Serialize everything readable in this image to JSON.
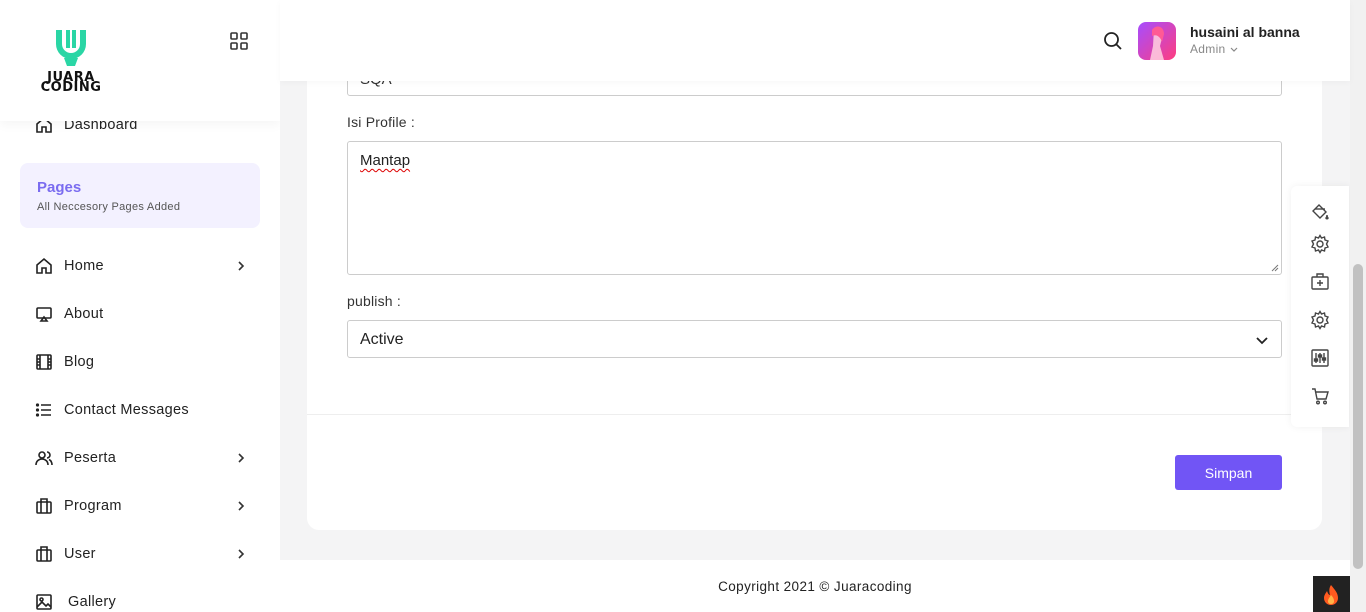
{
  "brand": {
    "logo_line1": "JUARA",
    "logo_line2": "CODING",
    "accent": "#2ad6a5"
  },
  "sidebar": {
    "dashboard_label": "Dashboard",
    "section": {
      "title": "Pages",
      "subtitle": "All Neccesory Pages Added"
    },
    "items": [
      {
        "label": "Home",
        "icon": "home-icon",
        "has_submenu": true
      },
      {
        "label": "About",
        "icon": "monitor-icon",
        "has_submenu": false
      },
      {
        "label": "Blog",
        "icon": "film-icon",
        "has_submenu": false
      },
      {
        "label": "Contact Messages",
        "icon": "list-icon",
        "has_submenu": false
      },
      {
        "label": "Peserta",
        "icon": "users-icon",
        "has_submenu": true
      },
      {
        "label": "Program",
        "icon": "briefcase-icon",
        "has_submenu": true
      },
      {
        "label": "User",
        "icon": "briefcase-icon",
        "has_submenu": true
      },
      {
        "label": "Gallery",
        "icon": "image-icon",
        "has_submenu": false
      }
    ]
  },
  "header": {
    "user_name": "husaini al banna",
    "user_role": "Admin"
  },
  "form": {
    "top_input_value": "SQA",
    "profile_label": "Isi Profile :",
    "profile_value": "Mantap",
    "publish_label": "publish :",
    "publish_selected": "Active",
    "submit_label": "Simpan"
  },
  "footer": {
    "copyright": "Copyright 2021 © Juaracoding"
  },
  "colors": {
    "primary": "#7155f5",
    "pages_bg": "#f3f1ff",
    "pages_title": "#7a6cf0"
  }
}
